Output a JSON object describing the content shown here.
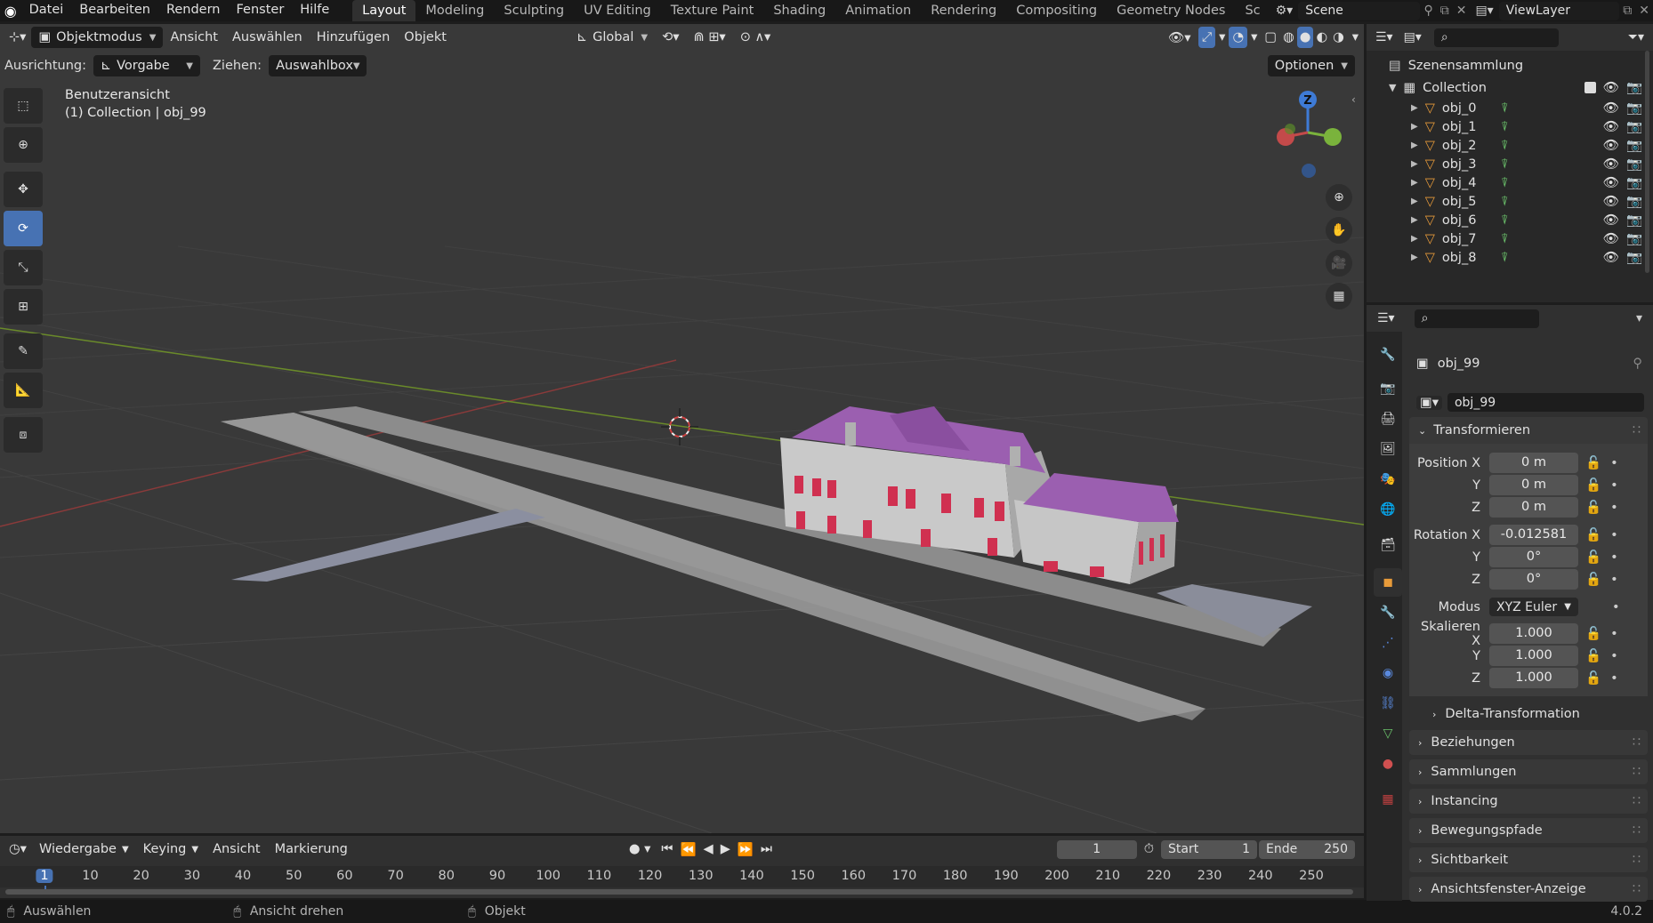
{
  "topbar": {
    "menu": [
      "Datei",
      "Bearbeiten",
      "Rendern",
      "Fenster",
      "Hilfe"
    ],
    "workspaces": [
      "Layout",
      "Modeling",
      "Sculpting",
      "UV Editing",
      "Texture Paint",
      "Shading",
      "Animation",
      "Rendering",
      "Compositing",
      "Geometry Nodes",
      "Sc"
    ],
    "active_workspace": "Layout",
    "scene": "Scene",
    "view_layer": "ViewLayer"
  },
  "viewport_header": {
    "mode": "Objektmodus",
    "menus": [
      "Ansicht",
      "Auswählen",
      "Hinzufügen",
      "Objekt"
    ],
    "transform_orientation": "Global",
    "alignment_label": "Ausrichtung:",
    "alignment_value": "Vorgabe",
    "drag_label": "Ziehen:",
    "drag_value": "Auswahlbox",
    "options": "Optionen"
  },
  "viewport": {
    "view_name": "Benutzeransicht",
    "context": "(1) Collection | obj_99",
    "gizmo_axis_label": "Z",
    "colors": {
      "background": "#393939",
      "grid": "#444444",
      "x_axis": "#8a3a3a",
      "y_axis": "#6a8a2a",
      "roof": "#9b5fb0",
      "walls": "#c8c8c8",
      "windows": "#d03050"
    }
  },
  "tools": [
    "select-box",
    "cursor",
    "move",
    "rotate",
    "scale",
    "transform",
    "annotate",
    "measure",
    "add-cube"
  ],
  "active_tool": "rotate",
  "timeline": {
    "menus": [
      "Wiedergabe",
      "Keying",
      "Ansicht",
      "Markierung"
    ],
    "current_frame": "1",
    "start_label": "Start",
    "start": "1",
    "end_label": "Ende",
    "end": "250",
    "ticks": [
      "1",
      "10",
      "20",
      "30",
      "40",
      "50",
      "60",
      "70",
      "80",
      "90",
      "100",
      "110",
      "120",
      "130",
      "140",
      "150",
      "160",
      "170",
      "180",
      "190",
      "200",
      "210",
      "220",
      "230",
      "240",
      "250"
    ]
  },
  "statusbar": {
    "items": [
      "Auswählen",
      "Ansicht drehen",
      "Objekt"
    ],
    "version": "4.0.2"
  },
  "outliner": {
    "root": "Szenensammlung",
    "collection": "Collection",
    "objects": [
      "obj_0",
      "obj_1",
      "obj_2",
      "obj_3",
      "obj_4",
      "obj_5",
      "obj_6",
      "obj_7",
      "obj_8"
    ]
  },
  "properties": {
    "object_name": "obj_99",
    "data_name": "obj_99",
    "transform_title": "Transformieren",
    "position_label": "Position X",
    "position": [
      "0 m",
      "0 m",
      "0 m"
    ],
    "rotation_label": "Rotation X",
    "rotation": [
      "-0.012581",
      "0°",
      "0°"
    ],
    "mode_label": "Modus",
    "mode": "XYZ Euler",
    "scale_label": "Skalieren X",
    "scale": [
      "1.000",
      "1.000",
      "1.000"
    ],
    "axis_y": "Y",
    "axis_z": "Z",
    "delta": "Delta-Transformation",
    "sections": [
      "Beziehungen",
      "Sammlungen",
      "Instancing",
      "Bewegungspfade",
      "Sichtbarkeit",
      "Ansichtsfenster-Anzeige"
    ]
  }
}
